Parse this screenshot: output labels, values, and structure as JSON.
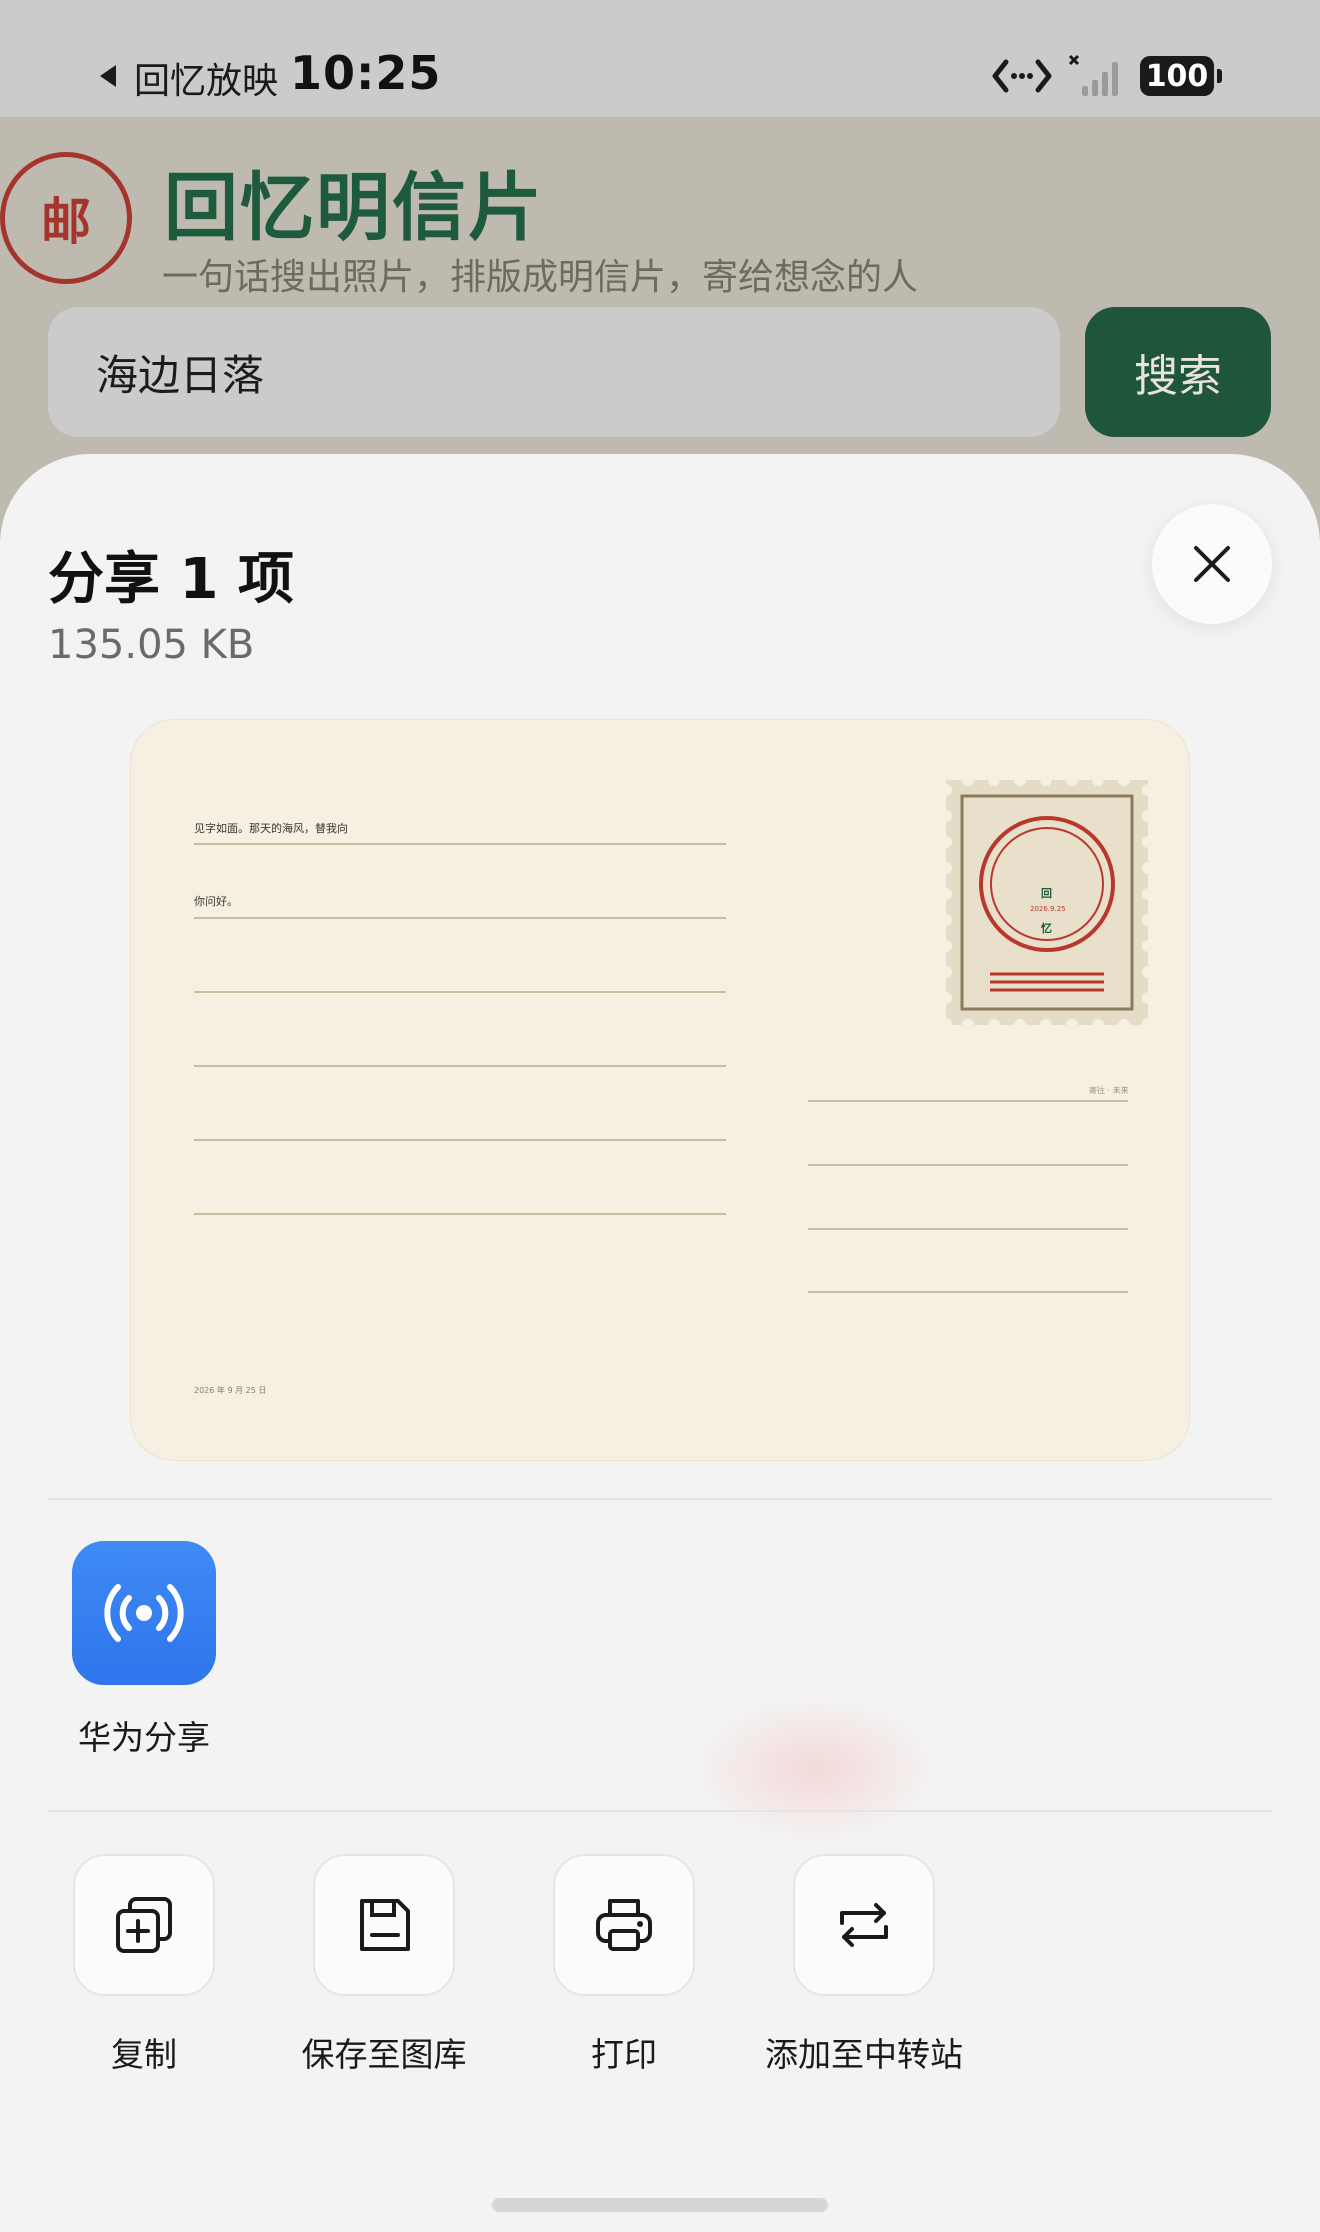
{
  "status_bar": {
    "back_app": "回忆放映",
    "time": "10:25",
    "battery": "100"
  },
  "app": {
    "logo_char": "邮",
    "title": "回忆明信片",
    "subtitle": "一句话搜出照片，排版成明信片，寄给想念的人",
    "search": {
      "value": "海边日落",
      "button_label": "搜索"
    }
  },
  "share_sheet": {
    "title": "分享 1 项",
    "file_size": "135.05 KB",
    "postcard": {
      "line1": "见字如面。那天的海风，替我向",
      "line2": "你问好。",
      "date": "2026 年 9 月 25 日",
      "address_label": "寄往 · 未来",
      "stamp": {
        "char_top": "回",
        "date": "2026.9.25",
        "char_bottom": "忆"
      }
    },
    "apps": [
      {
        "label": "华为分享",
        "icon": "huawei-share-icon"
      }
    ],
    "actions": [
      {
        "label": "复制",
        "icon": "copy-icon"
      },
      {
        "label": "保存至图库",
        "icon": "save-icon"
      },
      {
        "label": "打印",
        "icon": "print-icon"
      },
      {
        "label": "添加至中转站",
        "icon": "transfer-icon"
      }
    ]
  },
  "colors": {
    "brand_green": "#1f553a",
    "stamp_red": "#a4352c",
    "postcard_bg": "#f6f0e3",
    "huawei_blue": "#3080f0"
  }
}
